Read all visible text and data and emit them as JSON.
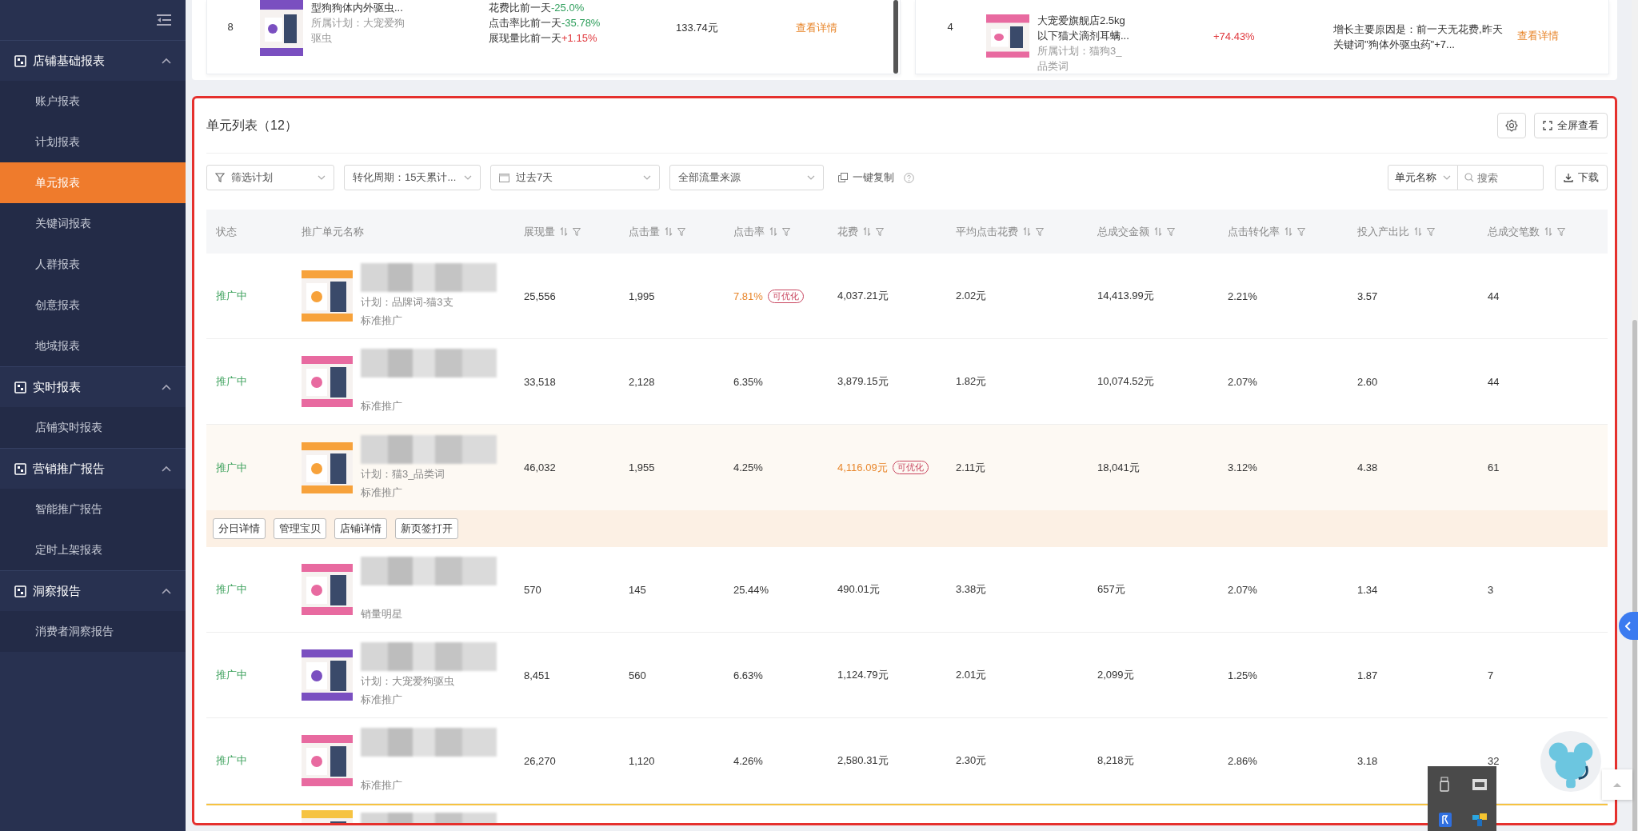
{
  "sidebar": {
    "groups": [
      {
        "label": "店铺基础报表",
        "expanded": true,
        "items": [
          {
            "label": "账户报表",
            "selected": false
          },
          {
            "label": "计划报表",
            "selected": false
          },
          {
            "label": "单元报表",
            "selected": true
          },
          {
            "label": "关键词报表",
            "selected": false
          },
          {
            "label": "人群报表",
            "selected": false
          },
          {
            "label": "创意报表",
            "selected": false
          },
          {
            "label": "地域报表",
            "selected": false
          }
        ]
      },
      {
        "label": "实时报表",
        "expanded": true,
        "items": [
          {
            "label": "店铺实时报表",
            "selected": false
          }
        ]
      },
      {
        "label": "营销推广报告",
        "expanded": true,
        "items": [
          {
            "label": "智能推广报告",
            "selected": false
          },
          {
            "label": "定时上架报表",
            "selected": false
          }
        ]
      },
      {
        "label": "洞察报告",
        "expanded": true,
        "items": [
          {
            "label": "消费者洞察报告",
            "selected": false
          }
        ]
      }
    ]
  },
  "top_cards": [
    {
      "kind": "metrics",
      "rank": "8",
      "name_lines": [
        "型狗狗体内外驱虫..."
      ],
      "plan_lines": [
        "所属计划：大宠爱狗",
        "驱虫"
      ],
      "metrics": [
        {
          "label": "花费比前一天",
          "change": "-25.0%",
          "color": "#2e9e5b"
        },
        {
          "label": "点击率比前一天",
          "change": "-35.78%",
          "color": "#2e9e5b"
        },
        {
          "label": "展现量比前一天",
          "change": "+1.15%",
          "color": "#e0393e"
        }
      ],
      "amount": "133.74元",
      "link": "查看详情"
    },
    {
      "kind": "reason",
      "rank": "4",
      "name_lines": [
        "大宠爱旗舰店2.5kg",
        "以下猫犬滴剂耳螨..."
      ],
      "plan_lines": [
        "所属计划：猫狗3_",
        "品类词"
      ],
      "change": "+74.43%",
      "color": "#e0393e",
      "reason_lines": [
        "增长主要原因是：前一天无花费,昨天",
        "关键词\"狗体外驱虫药\"+7..."
      ],
      "link": "查看详情"
    }
  ],
  "panel": {
    "title": "单元列表（12）",
    "fullscreen": "全屏查看",
    "filters": [
      {
        "kind": "funnel",
        "label": "筛选计划"
      },
      {
        "kind": "plain",
        "label": "转化周期：15天累计..."
      },
      {
        "kind": "calendar",
        "label": "过去7天"
      },
      {
        "kind": "plain",
        "label": "全部流量来源"
      }
    ],
    "copy": "一键复制",
    "search_scope": "单元名称",
    "search": {
      "placeholder": "搜索"
    },
    "download": "下载"
  },
  "table": {
    "columns": [
      "状态",
      "推广单元名称",
      "展现量",
      "点击量",
      "点击率",
      "花费",
      "平均点击花费",
      "总成交金额",
      "点击转化率",
      "投入产出比",
      "总成交笔数"
    ],
    "rows": [
      {
        "status": "推广中",
        "plan": "计划：品牌词-猫3支",
        "type": "标准推广",
        "selected": false,
        "cells": [
          "25,556",
          "1,995",
          {
            "value": "7.81%",
            "badge": "可优化"
          },
          "4,037.21元",
          "2.02元",
          "14,413.99元",
          "2.21%",
          "3.57",
          "44"
        ]
      },
      {
        "status": "推广中",
        "type": "标准推广",
        "selected": false,
        "cells": [
          "33,518",
          "2,128",
          "6.35%",
          "3,879.15元",
          "1.82元",
          "10,074.52元",
          "2.07%",
          "2.60",
          "44"
        ]
      },
      {
        "status": "推广中",
        "plan": "计划：猫3_品类词",
        "type": "标准推广",
        "selected": true,
        "cells": [
          "46,032",
          "1,955",
          "4.25%",
          {
            "value": "4,116.09元",
            "badge": "可优化"
          },
          "2.11元",
          "18,041元",
          "3.12%",
          "4.38",
          "61"
        ],
        "actions": [
          "分日详情",
          "管理宝贝",
          "店铺详情",
          "新页签打开"
        ]
      },
      {
        "status": "推广中",
        "type": "销量明星",
        "selected": false,
        "cells": [
          "570",
          "145",
          "25.44%",
          "490.01元",
          "3.38元",
          "657元",
          "2.07%",
          "1.34",
          "3"
        ]
      },
      {
        "status": "推广中",
        "plan": "计划：大宠爱狗驱虫",
        "type": "标准推广",
        "selected": false,
        "cells": [
          "8,451",
          "560",
          "6.63%",
          "1,124.79元",
          "2.01元",
          "2,099元",
          "1.25%",
          "1.87",
          "7"
        ]
      },
      {
        "status": "推广中",
        "type": "标准推广",
        "selected": false,
        "cells": [
          "26,270",
          "1,120",
          "4.26%",
          "2,580.31元",
          "2.30元",
          "8,218元",
          "2.86%",
          "3.18",
          "32"
        ]
      },
      {
        "cut": true,
        "selected": false
      }
    ]
  }
}
